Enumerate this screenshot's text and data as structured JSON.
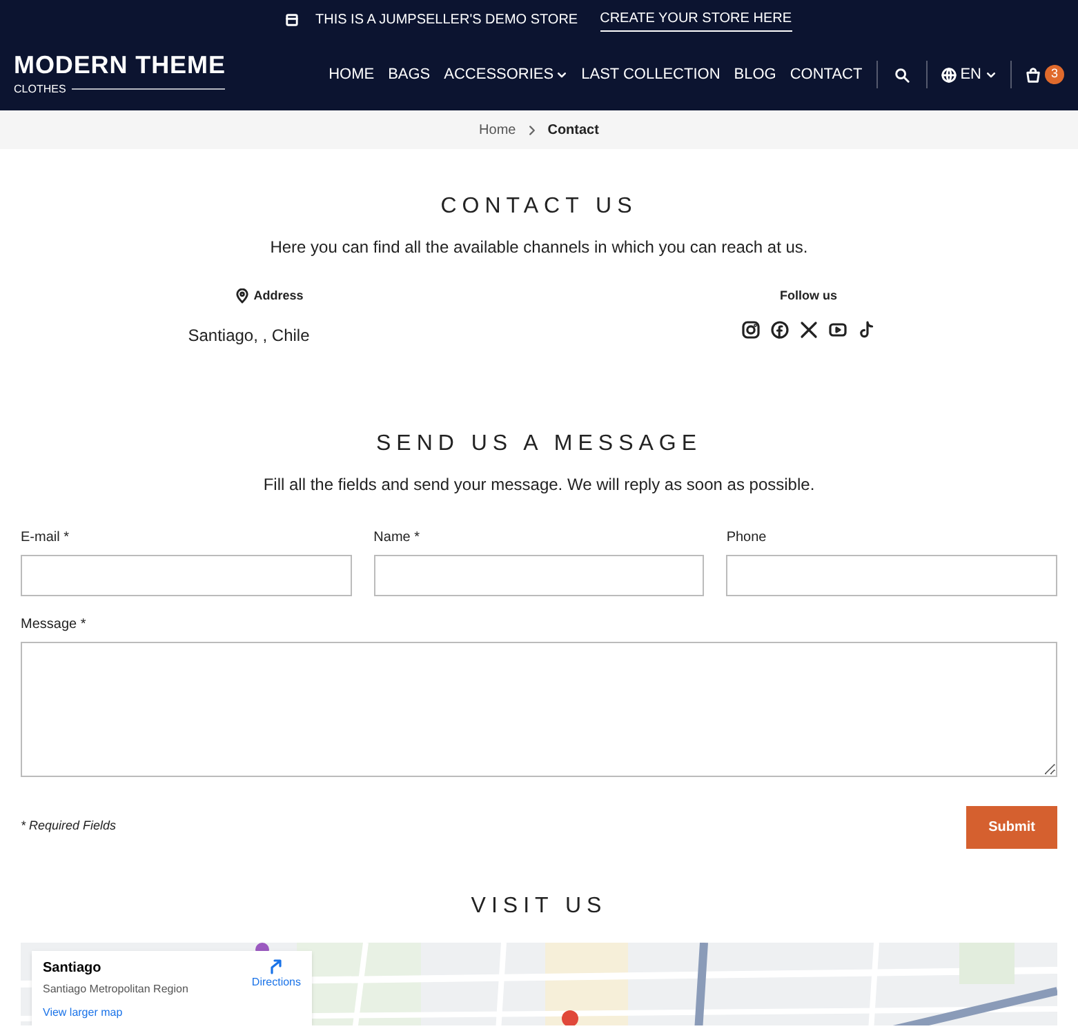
{
  "announcement": {
    "text": "THIS IS A JUMPSELLER'S DEMO STORE",
    "link": "CREATE YOUR STORE HERE"
  },
  "logo": {
    "title": "MODERN THEME",
    "subtitle": "CLOTHES"
  },
  "nav": [
    {
      "label": "HOME",
      "dropdown": false
    },
    {
      "label": "BAGS",
      "dropdown": false
    },
    {
      "label": "ACCESSORIES",
      "dropdown": true
    },
    {
      "label": "LAST COLLECTION",
      "dropdown": false
    },
    {
      "label": "BLOG",
      "dropdown": false
    },
    {
      "label": "CONTACT",
      "dropdown": false
    }
  ],
  "language": "EN",
  "cart_count": "3",
  "breadcrumb": [
    {
      "label": "Home",
      "current": false
    },
    {
      "label": "Contact",
      "current": true
    }
  ],
  "contact": {
    "title": "CONTACT US",
    "subtitle": "Here you can find all the available channels in which you can reach at us.",
    "address_label": "Address",
    "address": "Santiago, , Chile",
    "follow_label": "Follow us"
  },
  "message": {
    "title": "SEND US A MESSAGE",
    "subtitle": "Fill all the fields and send your message. We will reply as soon as possible.",
    "fields": [
      {
        "label": "E-mail *"
      },
      {
        "label": "Name *"
      },
      {
        "label": "Phone"
      }
    ],
    "message_label": "Message *",
    "required_note": "* Required Fields",
    "submit": "Submit"
  },
  "visit": {
    "title": "VISIT US",
    "map_card": {
      "place": "Santiago",
      "region": "Santiago Metropolitan Region",
      "directions": "Directions",
      "larger_map": "View larger map"
    }
  }
}
